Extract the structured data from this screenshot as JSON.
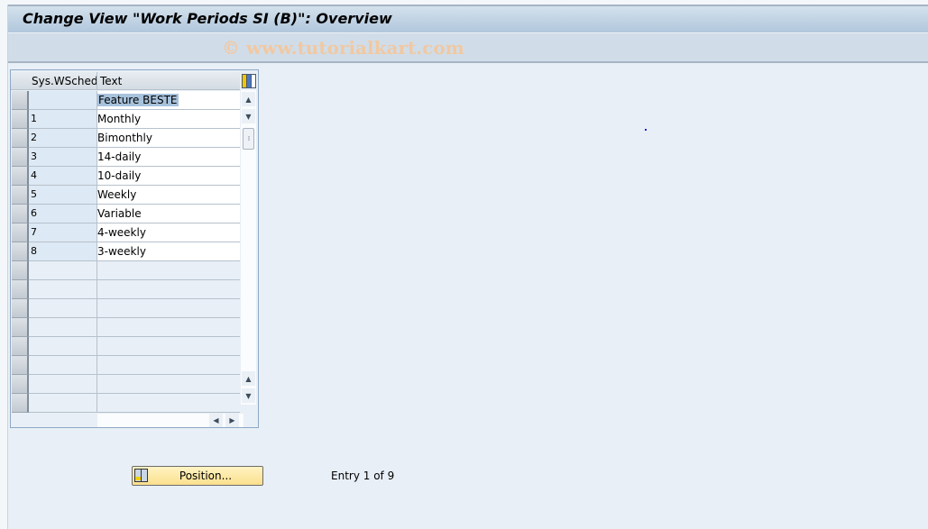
{
  "window": {
    "title": "Change View \"Work Periods SI (B)\": Overview",
    "watermark": "© www.tutorialkart.com"
  },
  "table": {
    "columns": [
      "Sys.WSched",
      "Text"
    ],
    "rows": [
      {
        "code": "",
        "text": "Feature BESTE",
        "highlighted": true
      },
      {
        "code": "1",
        "text": "Monthly"
      },
      {
        "code": "2",
        "text": "Bimonthly"
      },
      {
        "code": "3",
        "text": "14-daily"
      },
      {
        "code": "4",
        "text": "10-daily"
      },
      {
        "code": "5",
        "text": "Weekly"
      },
      {
        "code": "6",
        "text": "Variable"
      },
      {
        "code": "7",
        "text": "4-weekly"
      },
      {
        "code": "8",
        "text": "3-weekly"
      }
    ],
    "empty_rows": 8,
    "icons": {
      "settings": "table-settings-icon",
      "scroll_up": "▲",
      "scroll_down": "▼",
      "scroll_left": "◀",
      "scroll_right": "▶",
      "thumb_grip": "⁞⁞"
    }
  },
  "footer": {
    "position_button_label": "Position...",
    "entry_info": "Entry 1 of 9"
  }
}
